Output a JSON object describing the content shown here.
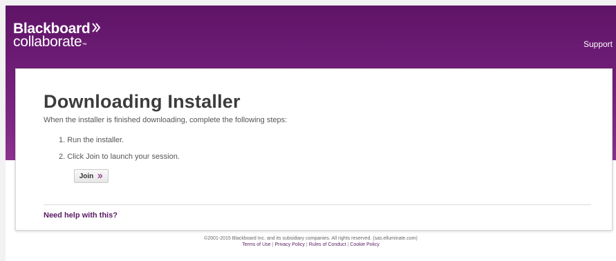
{
  "header": {
    "logo_line1": "Blackboard",
    "logo_line2": "collaborate",
    "logo_tm": "™",
    "support_label": "Support"
  },
  "main": {
    "title": "Downloading Installer",
    "intro": "When the installer is finished downloading, complete the following steps:",
    "steps": [
      "1. Run the installer.",
      "2. Click Join to launch your session."
    ],
    "join_label": "Join",
    "help_link": "Need help with this?"
  },
  "footer": {
    "copyright": "©2001-2015 Blackboard Inc. and its subsidiary companies. All rights reserved. (sas.elluminate.com)",
    "links": [
      "Terms of Use",
      "Privacy Policy",
      "Rules of Conduct",
      "Cookie Policy"
    ],
    "separator": "|"
  },
  "colors": {
    "brand_purple": "#6f1d77",
    "link_purple": "#5a1a63",
    "page_background": "#ffffff"
  },
  "icons": {
    "logo_mark": "double-chevron-right-icon",
    "join_button": "double-chevron-right-icon"
  }
}
